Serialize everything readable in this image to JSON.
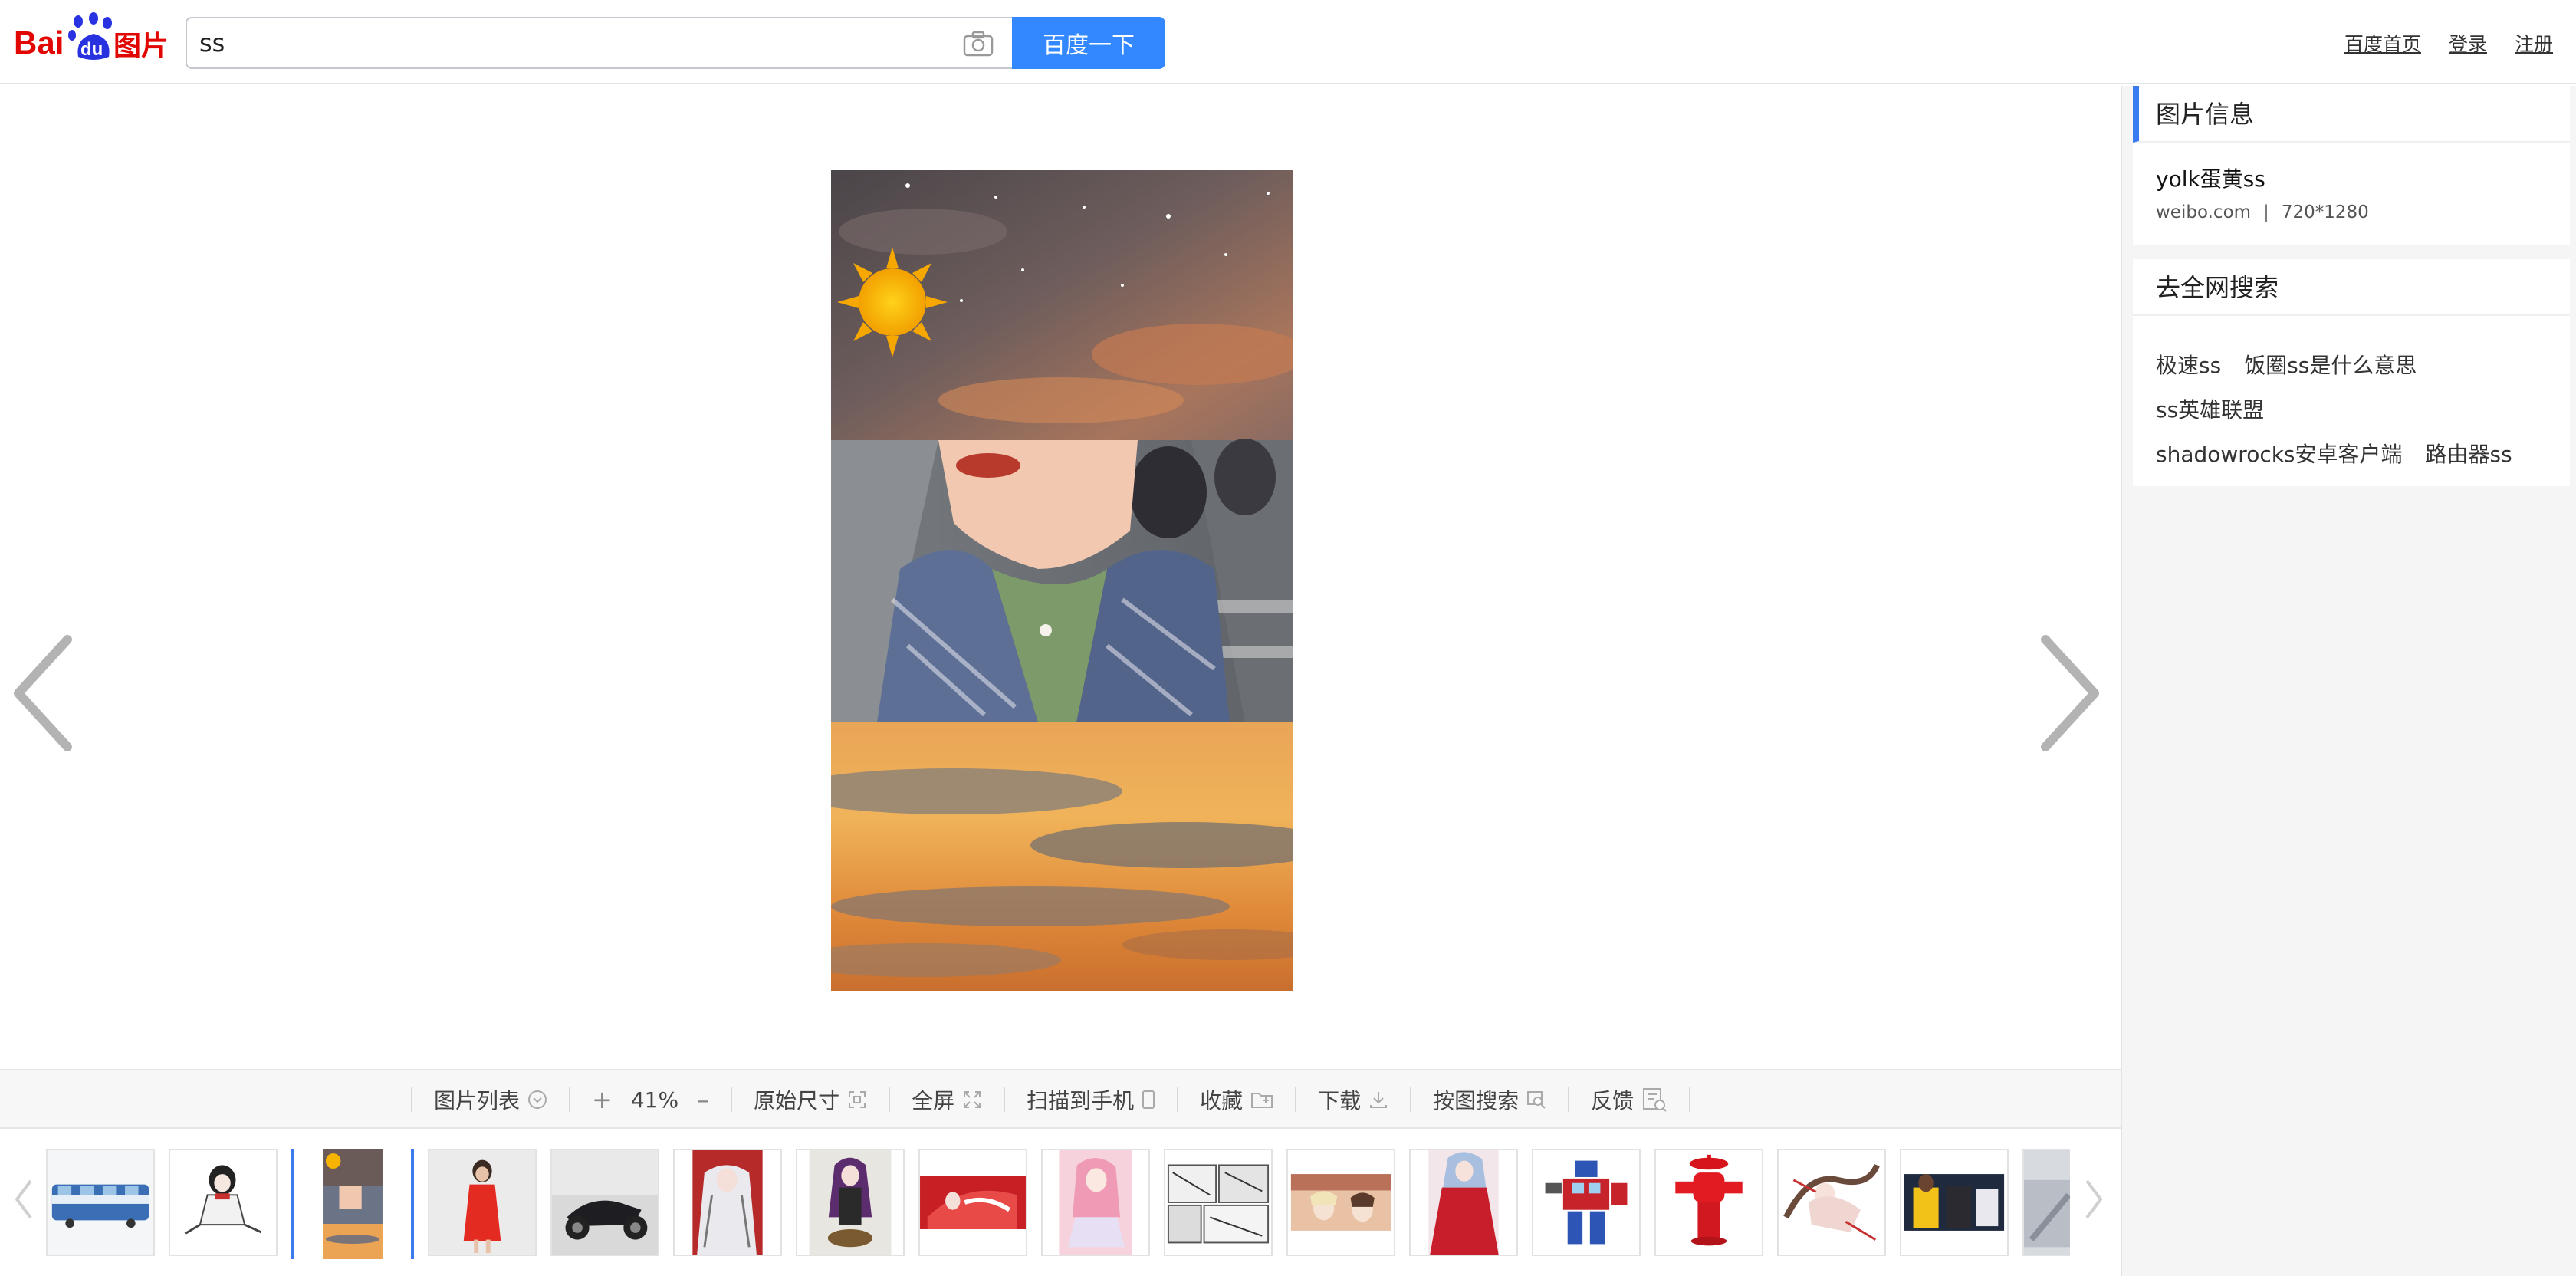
{
  "header": {
    "logo_text_1": "Bai",
    "logo_text_2": "du",
    "logo_text_3": "图片",
    "search_value": "ss",
    "search_button": "百度一下",
    "links": [
      "百度首页",
      "登录",
      "注册"
    ]
  },
  "panel": {
    "info_heading": "图片信息",
    "image_title": "yolk蛋黄ss",
    "source": "weibo.com",
    "separator": "|",
    "dimensions": "720*1280",
    "search_heading": "去全网搜索",
    "keywords": [
      [
        "极速ss",
        "饭圈ss是什么意思"
      ],
      [
        "ss英雄联盟"
      ],
      [
        "shadowrocks安卓客户端",
        "路由器ss"
      ]
    ]
  },
  "toolbar": {
    "image_list": "图片列表",
    "zoom_in": "+",
    "zoom_level": "41%",
    "zoom_out": "–",
    "original_size": "原始尺寸",
    "fullscreen": "全屏",
    "scan_to_phone": "扫描到手机",
    "favorite": "收藏",
    "download": "下载",
    "search_by_image": "按图搜索",
    "feedback": "反馈"
  },
  "colors": {
    "accent": "#3a7cf0",
    "search_button": "#3388ff",
    "baidu_red": "#e10602",
    "baidu_blue": "#2932e1"
  },
  "thumbnails": [
    "train",
    "anime-girl-sketch",
    "sky-collage",
    "red-dress-woman",
    "motorcycle",
    "anime-red-white",
    "anime-purple-hair",
    "anime-red-banner",
    "anime-pink",
    "manga-page",
    "anime-scene",
    "anime-red-dress",
    "robot-toy",
    "fire-hydrant",
    "anime-dance",
    "basketball-player",
    "partial-thumb"
  ]
}
